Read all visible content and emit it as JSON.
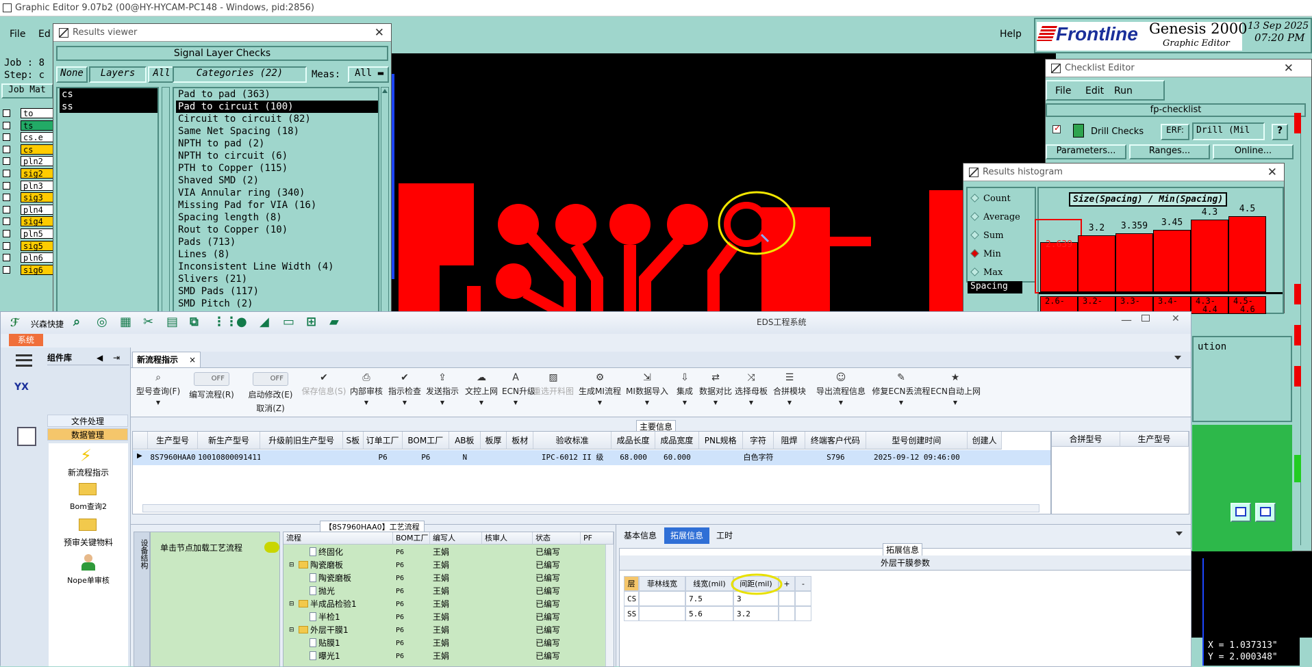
{
  "os_title": "Graphic Editor 9.07b2 (00@HY-HYCAM-PC148 - Windows, pid:2856)",
  "genesis": {
    "menu": {
      "file": "File",
      "edit_short": "Ed",
      "help": "Help"
    },
    "brand": "Frontline",
    "product": "Genesis 2000",
    "subtitle": "Graphic Editor",
    "date": "13 Sep 2025",
    "time": "07:20 PM",
    "job_label": "Job : 8",
    "step_label": "Step: c",
    "job_matrix": "Job Mat",
    "layers": [
      {
        "name": "to",
        "color": "#ffffff"
      },
      {
        "name": "ts",
        "color": "#22aa66"
      },
      {
        "name": "cs.e",
        "color": "#ffffff"
      },
      {
        "name": "cs",
        "color": "#ffcc00"
      },
      {
        "name": "pln2",
        "color": "#ffffff"
      },
      {
        "name": "sig2",
        "color": "#ffcc00"
      },
      {
        "name": "pln3",
        "color": "#ffffff"
      },
      {
        "name": "sig3",
        "color": "#ffcc00"
      },
      {
        "name": "pln4",
        "color": "#ffffff"
      },
      {
        "name": "sig4",
        "color": "#ffcc00"
      },
      {
        "name": "pln5",
        "color": "#ffffff"
      },
      {
        "name": "sig5",
        "color": "#ffcc00"
      },
      {
        "name": "pln6",
        "color": "#ffffff"
      },
      {
        "name": "sig6",
        "color": "#ffcc00"
      }
    ],
    "coords": {
      "x": "X = 1.037313\"",
      "y": "Y = 2.000348\""
    }
  },
  "results_viewer": {
    "title": "Results viewer",
    "section": "Signal Layer Checks",
    "none_btn": "None",
    "layers_btn": "Layers",
    "all_btn": "All",
    "categories_btn": "Categories (22)",
    "meas_label": "Meas:",
    "meas_value": "All",
    "layer_list": [
      "cs",
      "ss"
    ],
    "categories": [
      "Pad to pad (363)",
      "Pad to circuit (100)",
      "Circuit to circuit (82)",
      "Same Net Spacing (18)",
      "NPTH to pad (2)",
      "NPTH to circuit (6)",
      "PTH to Copper (115)",
      "Shaved SMD (2)",
      "VIA Annular ring (340)",
      "Missing Pad for VIA (16)",
      "Spacing length (8)",
      "Rout to Copper (10)",
      "Pads (713)",
      "Lines (8)",
      "Inconsistent Line Width (4)",
      "Slivers (21)",
      "SMD Pads (117)",
      "SMD Pitch (2)"
    ],
    "selected_index": 1
  },
  "checklist_editor": {
    "title": "Checklist Editor",
    "menu": [
      "File",
      "Edit",
      "Run"
    ],
    "checklist_name": "fp-checklist",
    "check_name": "Drill Checks",
    "erf_label": "ERF:",
    "erf_value": "Drill (Mil",
    "help": "?",
    "buttons": [
      "Parameters...",
      "Ranges...",
      "Online..."
    ],
    "partial_label": "ution"
  },
  "histogram": {
    "title": "Results histogram",
    "options": [
      "Count",
      "Average",
      "Sum",
      "Min",
      "Max"
    ],
    "selected_option": "Min",
    "field_value": "Spacing",
    "chart_title": "Size(Spacing) / Min(Spacing)",
    "bars": [
      {
        "value_label": "2.639",
        "range": "2.6-",
        "level": 0.29,
        "highlight": true
      },
      {
        "value_label": "3.2",
        "range": "3.2-",
        "level": 0.33
      },
      {
        "value_label": "3.359",
        "range": "3.3-",
        "level": 0.34
      },
      {
        "value_label": "3.45",
        "range": "3.4-",
        "level": 0.36
      },
      {
        "value_label": "4.3",
        "range": "4.3-",
        "range2": "4.4",
        "level": 0.42
      },
      {
        "value_label": "4.5",
        "range": "4.5-",
        "range2": "4.6",
        "level": 0.44
      }
    ]
  },
  "eds": {
    "title": "EDS工程系统",
    "quick_launch": "兴森快捷",
    "system_tab": "系统",
    "sidebar": {
      "header": "组件库",
      "sections": [
        "文件处理",
        "数据管理"
      ],
      "items": [
        "新流程指示",
        "Bom查询2",
        "预审关键物料",
        "Nope单审核"
      ]
    },
    "doc_tab": "新流程指示",
    "toolbar": [
      {
        "label": "型号查询(F)",
        "icon": "search",
        "disabled": false
      },
      {
        "label": "编写流程(R)",
        "icon": "toggle",
        "disabled": false
      },
      {
        "label": "启动修改(E)",
        "label2": "取消(Z)",
        "icon": "toggle",
        "disabled": false
      },
      {
        "label": "保存信息(S)",
        "icon": "check",
        "disabled": true
      },
      {
        "label": "内部审核",
        "icon": "print",
        "disabled": false
      },
      {
        "label": "指示检查",
        "icon": "check",
        "disabled": false
      },
      {
        "label": "发送指示",
        "icon": "upload",
        "disabled": false
      },
      {
        "label": "文控上网",
        "icon": "cloud",
        "disabled": false
      },
      {
        "label": "ECN升级",
        "icon": "ecn",
        "disabled": false
      },
      {
        "label": "重选开料图",
        "icon": "image",
        "disabled": true
      },
      {
        "label": "生成MI流程",
        "icon": "gear",
        "disabled": false
      },
      {
        "label": "MI数据导入",
        "icon": "import",
        "disabled": false
      },
      {
        "label": "集成",
        "icon": "download",
        "disabled": false
      },
      {
        "label": "数据对比",
        "icon": "compare",
        "disabled": false
      },
      {
        "label": "选择母板",
        "icon": "shuffle",
        "disabled": false
      },
      {
        "label": "合拼模块",
        "icon": "list",
        "disabled": false
      },
      {
        "label": "导出流程信息",
        "icon": "smile",
        "disabled": false
      },
      {
        "label": "修复ECN丢流程",
        "icon": "wrench",
        "disabled": false
      },
      {
        "label": "ECN自动上网",
        "icon": "star",
        "disabled": false
      }
    ],
    "toggle_off": "OFF",
    "main_info_label": "主要信息",
    "main_table": {
      "columns": [
        "生产型号",
        "新生产型号",
        "升级前旧生产型号",
        "S板",
        "订单工厂",
        "BOM工厂",
        "AB板",
        "板厚",
        "板材",
        "验收标准",
        "成品长度",
        "成品宽度",
        "PNL规格",
        "字符",
        "阻焊",
        "终端客户代码",
        "型号创建时间",
        "创建人"
      ],
      "rows": [
        [
          "8S7960HAA0",
          "10010800091411",
          "",
          "",
          "P6",
          "P6",
          "N",
          "",
          "",
          "IPC-6012 II 级",
          "68.000",
          "60.000",
          "",
          "白色字符",
          "",
          "S796",
          "2025-09-12 09:46:00",
          ""
        ]
      ]
    },
    "merge_table": {
      "columns": [
        "合拼型号",
        "生产型号"
      ]
    },
    "process_title": "【8S7960HAA0】工艺流程",
    "side_tab": "设备结构",
    "click_hint": "单击节点加载工艺流程",
    "process_columns": [
      "流程",
      "BOM工厂",
      "编写人",
      "核审人",
      "状态",
      "PF"
    ],
    "process_rows": [
      {
        "name": "终固化",
        "level": 2,
        "folder": false,
        "bom": "P6",
        "author": "王娟",
        "status": "已编写"
      },
      {
        "name": "陶瓷磨板",
        "level": 1,
        "folder": true,
        "bom": "P6",
        "author": "王娟",
        "status": "已编写"
      },
      {
        "name": "陶瓷磨板",
        "level": 2,
        "folder": false,
        "bom": "P6",
        "author": "王娟",
        "status": "已编写"
      },
      {
        "name": "抛光",
        "level": 2,
        "folder": false,
        "bom": "P6",
        "author": "王娟",
        "status": "已编写"
      },
      {
        "name": "半成品检验1",
        "level": 1,
        "folder": true,
        "bom": "P6",
        "author": "王娟",
        "status": "已编写"
      },
      {
        "name": "半检1",
        "level": 2,
        "folder": false,
        "bom": "P6",
        "author": "王娟",
        "status": "已编写"
      },
      {
        "name": "外层干膜1",
        "level": 1,
        "folder": true,
        "bom": "P6",
        "author": "王娟",
        "status": "已编写"
      },
      {
        "name": "贴膜1",
        "level": 2,
        "folder": false,
        "bom": "P6",
        "author": "王娟",
        "status": "已编写"
      },
      {
        "name": "曝光1",
        "level": 2,
        "folder": false,
        "bom": "P6",
        "author": "王娟",
        "status": "已编写"
      }
    ],
    "right_tabs": [
      "基本信息",
      "拓展信息",
      "工时"
    ],
    "active_right_tab": "拓展信息",
    "ext_label": "拓展信息",
    "param_title": "外层干膜参数",
    "param_columns": [
      "层",
      "菲林线宽",
      "线宽(mil)",
      "间距(mil)",
      "+",
      "-"
    ],
    "param_rows": [
      [
        "CS",
        "",
        "7.5",
        "3"
      ],
      [
        "SS",
        "",
        "5.6",
        "3.2"
      ]
    ]
  }
}
